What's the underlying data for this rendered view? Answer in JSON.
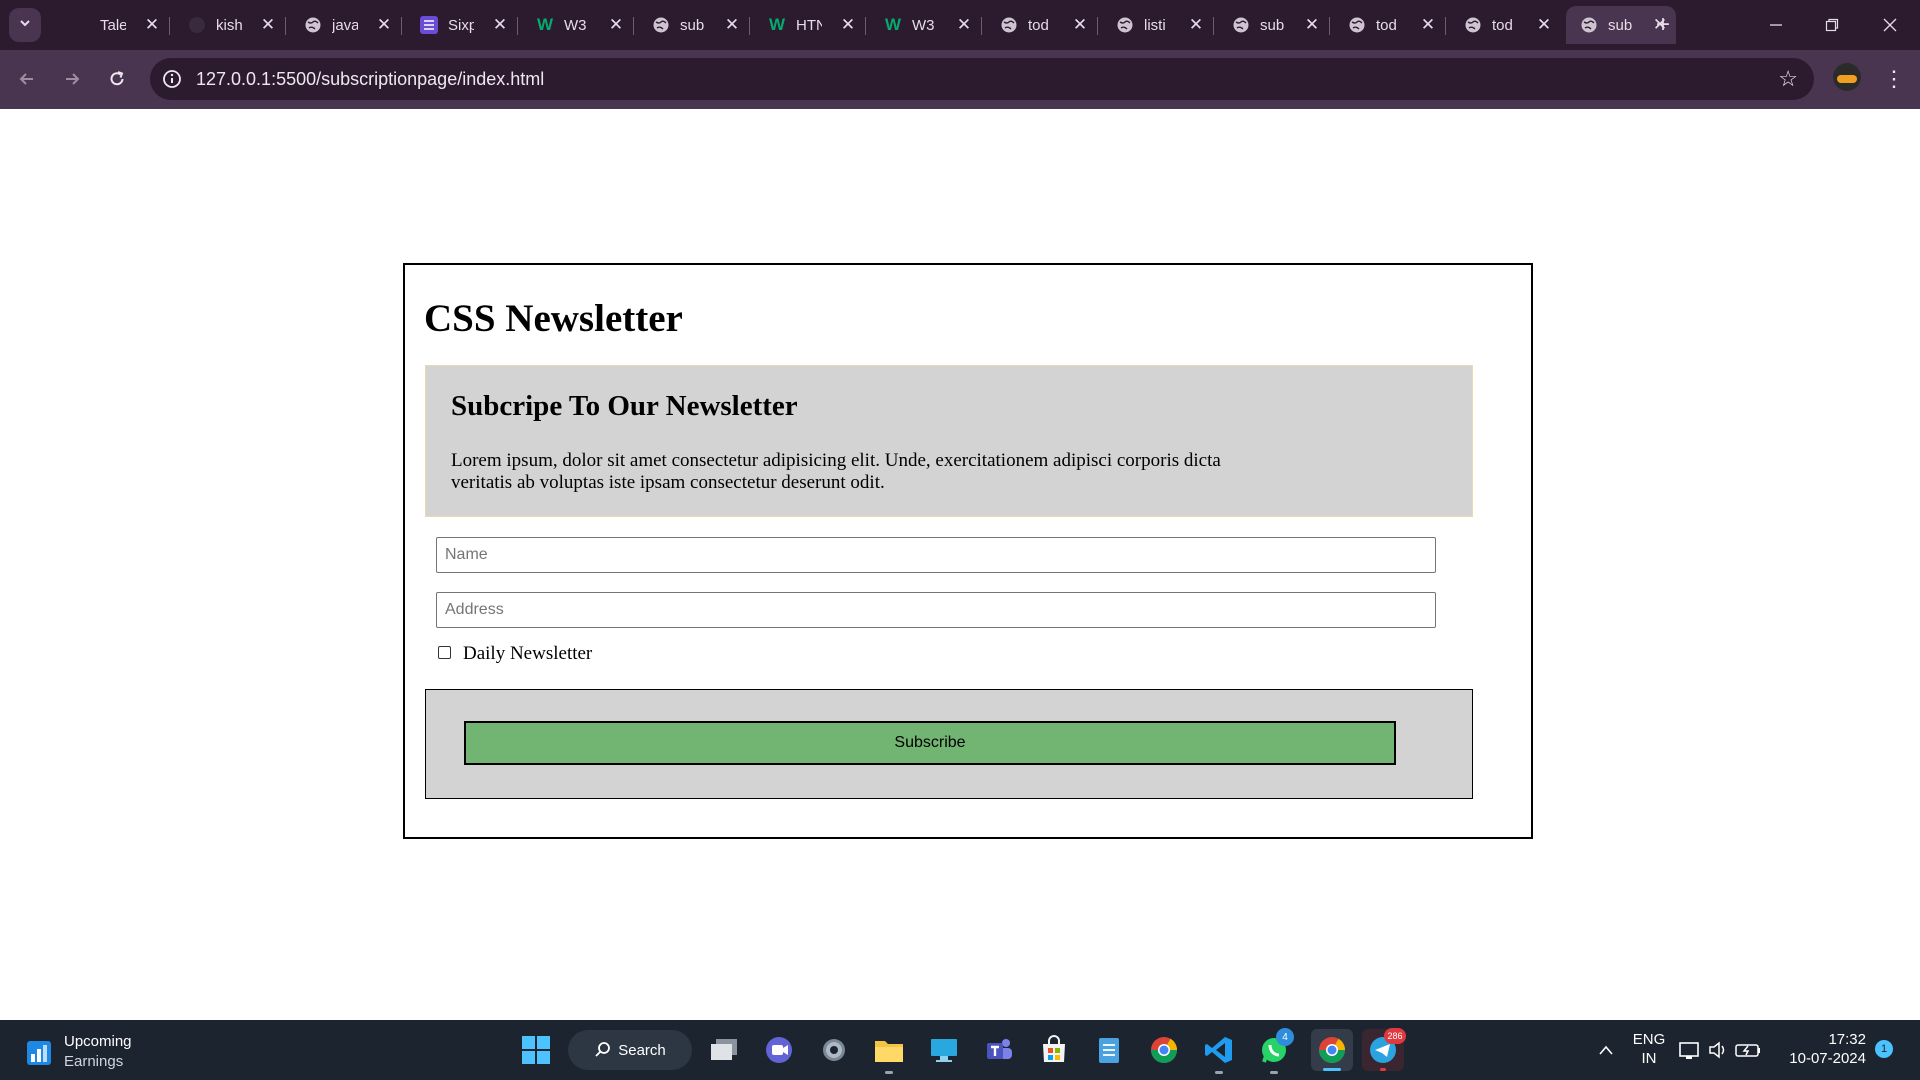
{
  "browser": {
    "tabs": [
      {
        "title": "Tale",
        "icon": "blank-icon"
      },
      {
        "title": "kish",
        "icon": "github-icon"
      },
      {
        "title": "java",
        "icon": "globe-icon"
      },
      {
        "title": "Sixp",
        "icon": "list-icon"
      },
      {
        "title": "W3",
        "icon": "w3schools-icon"
      },
      {
        "title": "sub",
        "icon": "globe-icon"
      },
      {
        "title": "HTN",
        "icon": "w3schools-icon"
      },
      {
        "title": "W3",
        "icon": "w3schools-icon"
      },
      {
        "title": "tod",
        "icon": "globe-icon"
      },
      {
        "title": "listi",
        "icon": "globe-icon"
      },
      {
        "title": "sub",
        "icon": "globe-icon"
      },
      {
        "title": "tod",
        "icon": "globe-icon"
      },
      {
        "title": "tod",
        "icon": "globe-icon"
      },
      {
        "title": "sub",
        "icon": "globe-icon",
        "active": true
      }
    ],
    "url": "127.0.0.1:5500/subscriptionpage/index.html"
  },
  "page": {
    "heading": "CSS Newsletter",
    "hero": {
      "title": "Subcripe To Our Newsletter",
      "text": "Lorem ipsum, dolor sit amet consectetur adipisicing elit. Unde, exercitationem adipisci corporis dicta veritatis ab voluptas iste ipsam consectetur deserunt odit."
    },
    "form": {
      "name_placeholder": "Name",
      "address_placeholder": "Address",
      "checkbox_label": "Daily Newsletter",
      "checkbox_checked": false,
      "submit_label": "Subscribe"
    }
  },
  "taskbar": {
    "widget_title": "Upcoming",
    "widget_subtitle": "Earnings",
    "search_label": "Search",
    "whatsapp_badge": "4",
    "telegram_badge": "286",
    "lang_top": "ENG",
    "lang_bottom": "IN",
    "time": "17:32",
    "date": "10-07-2024",
    "notification_count": "1"
  },
  "colors": {
    "tab_strip": "#2c1a2f",
    "toolbar": "#4a3550",
    "panel_gray": "#d3d3d3",
    "subscribe_green": "#72b572",
    "taskbar": "#1c2430"
  }
}
